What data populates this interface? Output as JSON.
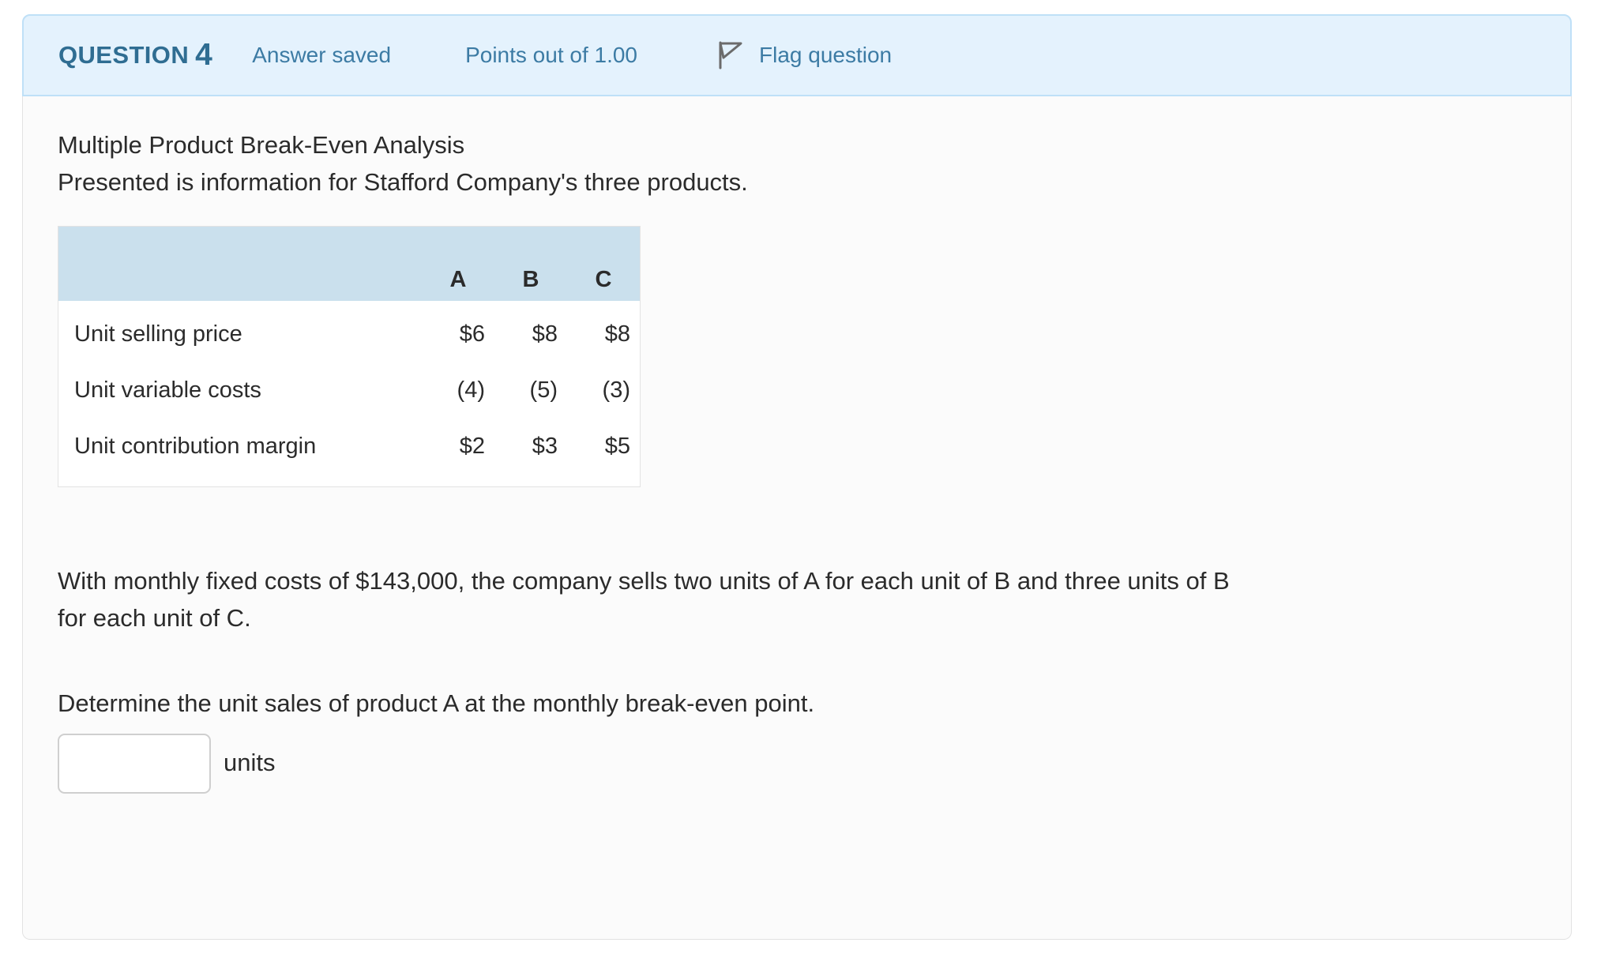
{
  "question": {
    "header": {
      "label": "QUESTION",
      "number": "4",
      "state": "Answer saved",
      "points": "Points out of 1.00",
      "flag_label": "Flag question",
      "flag_icon": "flag-pennant-icon",
      "background_color": "#e4f2fd",
      "border_color": "#bfe0f7",
      "text_color": "#3c7ba4"
    },
    "body": {
      "title": "Multiple Product Break-Even Analysis",
      "intro": "Presented is information for Stafford Company's three products.",
      "table": {
        "header_background": "#cae0ed",
        "row_label_header": "",
        "columns": [
          "A",
          "B",
          "C"
        ],
        "rows": [
          {
            "label": "Unit selling price",
            "values": [
              "$6",
              "$8",
              "$8"
            ]
          },
          {
            "label": "Unit variable costs",
            "values": [
              "(4)",
              "(5)",
              "(3)"
            ]
          },
          {
            "label": "Unit contribution margin",
            "values": [
              "$2",
              "$3",
              "$5"
            ]
          }
        ]
      },
      "scenario": "With monthly fixed costs of $143,000, the company sells two units of A for each unit of B and three units of B for each unit of C.",
      "prompt": "Determine the unit sales of product A at the monthly break-even point.",
      "answer": {
        "value": "",
        "placeholder": "",
        "unit_label": "units"
      }
    }
  }
}
